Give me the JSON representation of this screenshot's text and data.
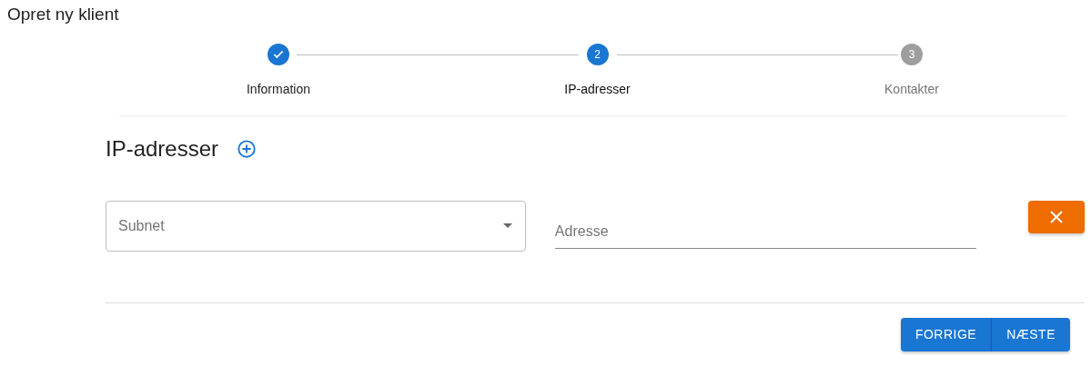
{
  "page": {
    "title": "Opret ny klient"
  },
  "stepper": {
    "steps": [
      {
        "label": "Information",
        "completed": true,
        "selected": false
      },
      {
        "label": "IP-adresser",
        "number": "2",
        "completed": false,
        "selected": true
      },
      {
        "label": "Kontakter",
        "number": "3",
        "completed": false,
        "selected": false
      }
    ]
  },
  "section": {
    "heading": "IP-adresser"
  },
  "ip_rows": [
    {
      "subnet": {
        "placeholder": "Subnet"
      },
      "address": {
        "placeholder": "Adresse"
      }
    }
  ],
  "footer": {
    "buttons": [
      "FORRIGE",
      "NÆSTE"
    ]
  }
}
